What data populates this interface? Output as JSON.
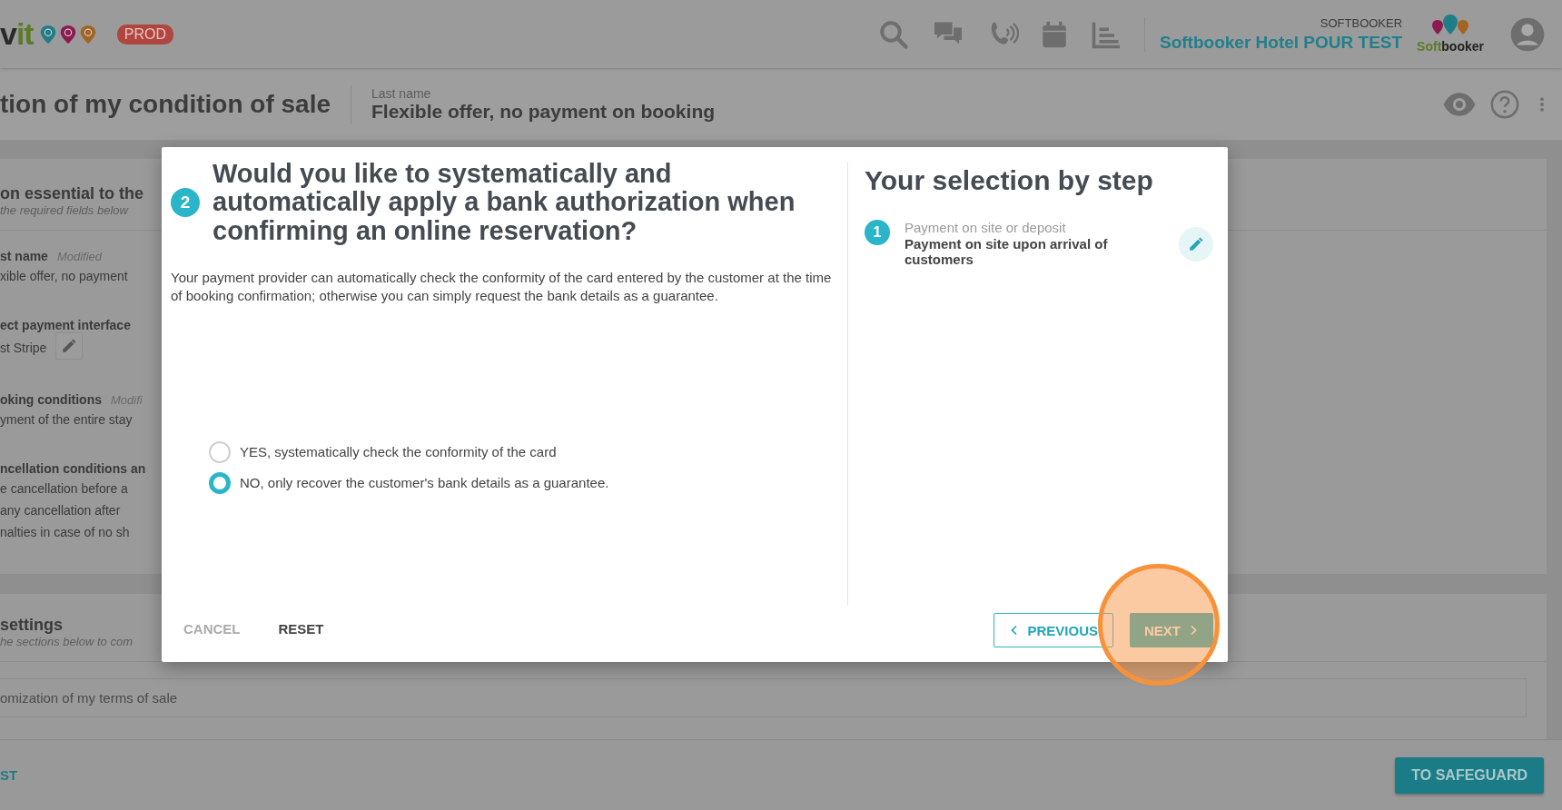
{
  "header": {
    "logo_first": "v",
    "logo_second": "it",
    "env_badge": "PROD",
    "account_label": "SOFTBOOKER",
    "hotel_name": "Softbooker Hotel POUR TEST",
    "brand_first": "Soft",
    "brand_second": "booker"
  },
  "page_header": {
    "title": "tion of my condition of sale",
    "field_label": "Last name",
    "field_value": "Flexible offer, no payment on booking"
  },
  "background_form": {
    "section_title": "on essential to the",
    "section_hint": "the required fields below",
    "fields": [
      {
        "kind": "text",
        "label": "st name",
        "status": "Modified",
        "lines": [
          "xible offer, no payment"
        ]
      },
      {
        "kind": "editable",
        "label": "ect payment interface",
        "lines": [
          "st Stripe"
        ]
      },
      {
        "kind": "text",
        "label": "oking conditions",
        "status": "Modifi",
        "lines": [
          "yment of the entire stay"
        ]
      },
      {
        "kind": "text",
        "label": "ncellation conditions an",
        "lines": [
          "e cancellation before a",
          "any cancellation after",
          "nalties in case of no sh"
        ]
      }
    ]
  },
  "settings_section": {
    "title": "settings",
    "hint": "he sections below to com",
    "item": "omization of my terms of sale"
  },
  "footer": {
    "link": "ST",
    "save_button": "TO SAFEGUARD"
  },
  "dialog": {
    "step_number": "2",
    "question": "Would you like to systematically and automatically apply a bank authorization when confirming an online reservation?",
    "description": "Your payment provider can automatically check the conformity of the card entered by the customer at the time of booking confirmation; otherwise you can simply request the bank details as a guarantee.",
    "options": [
      {
        "label": "YES, systematically check the conformity of the card",
        "selected": false
      },
      {
        "label": "NO, only recover the customer's bank details as a guarantee.",
        "selected": true
      }
    ],
    "cancel": "CANCEL",
    "reset": "RESET",
    "previous": "PREVIOUS",
    "next": "NEXT",
    "summary": {
      "title": "Your selection by step",
      "steps": [
        {
          "number": "1",
          "label": "Payment on site or deposit",
          "value": "Payment on site upon arrival of customers"
        }
      ]
    }
  },
  "annotation": {
    "kind": "circle"
  }
}
